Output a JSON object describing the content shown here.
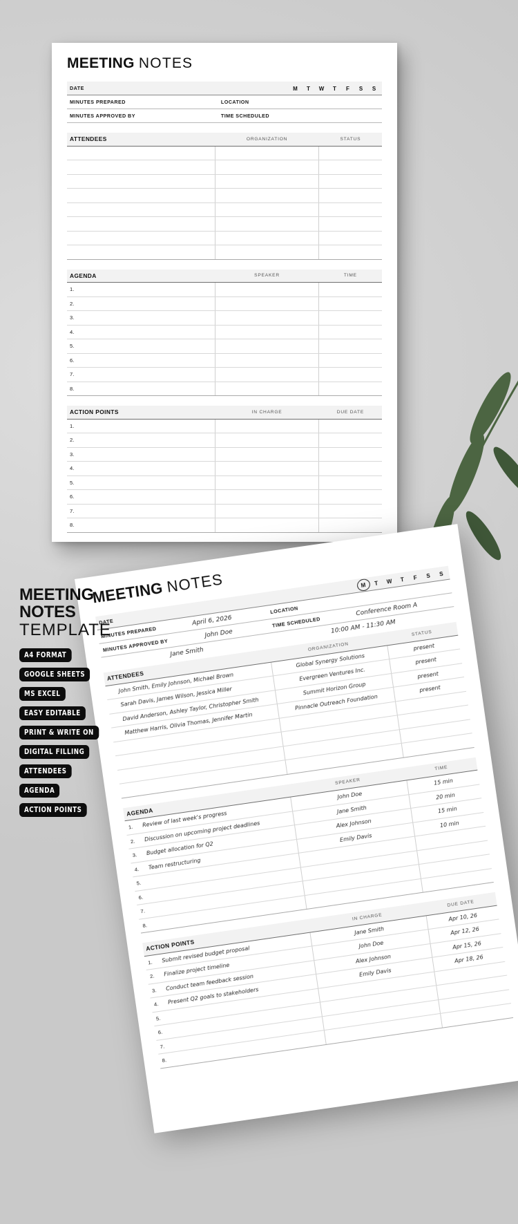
{
  "document": {
    "title_bold": "MEETING",
    "title_light": "NOTES",
    "meta": {
      "date_label": "DATE",
      "minutes_prepared_label": "MINUTES PREPARED",
      "minutes_approved_label": "MINUTES APPROVED BY",
      "location_label": "LOCATION",
      "time_scheduled_label": "TIME SCHEDULED",
      "days": [
        "M",
        "T",
        "W",
        "T",
        "F",
        "S",
        "S"
      ]
    },
    "attendees": {
      "header": "ATTENDEES",
      "col_organization": "ORGANIZATION",
      "col_status": "STATUS",
      "rows": 8
    },
    "agenda": {
      "header": "AGENDA",
      "col_speaker": "SPEAKER",
      "col_time": "TIME",
      "rows": 8
    },
    "action_points": {
      "header": "ACTION POINTS",
      "col_in_charge": "IN CHARGE",
      "col_due_date": "DUE DATE",
      "rows": 8
    }
  },
  "filled": {
    "date": "April 6, 2026",
    "minutes_prepared": "John Doe",
    "minutes_approved_by": "Jane Smith",
    "location": "Conference Room A",
    "time_scheduled": "10:00 AM - 11:30 AM",
    "day_selected": "M",
    "attendees": [
      {
        "names": "John Smith, Emily Johnson, Michael Brown",
        "organization": "Global Synergy Solutions",
        "status": "present"
      },
      {
        "names": "Sarah Davis, James Wilson, Jessica Miller",
        "organization": "Evergreen Ventures Inc.",
        "status": "present"
      },
      {
        "names": "David Anderson, Ashley Taylor, Christopher Smith",
        "organization": "Summit Horizon Group",
        "status": "present"
      },
      {
        "names": "Matthew Harris, Olivia Thomas, Jennifer Martin",
        "organization": "Pinnacle Outreach Foundation",
        "status": "present"
      }
    ],
    "agenda": [
      {
        "item": "Review of last week's progress",
        "speaker": "John Doe",
        "time": "15 min"
      },
      {
        "item": "Discussion on upcoming project deadlines",
        "speaker": "Jane Smith",
        "time": "20 min"
      },
      {
        "item": "Budget allocation for Q2",
        "speaker": "Alex Johnson",
        "time": "15 min"
      },
      {
        "item": "Team restructuring",
        "speaker": "Emily Davis",
        "time": "10 min"
      }
    ],
    "action_points": [
      {
        "item": "Submit revised budget proposal",
        "in_charge": "Jane Smith",
        "due_date": "Apr 10, 26"
      },
      {
        "item": "Finalize project timeline",
        "in_charge": "John Doe",
        "due_date": "Apr 12, 26"
      },
      {
        "item": "Conduct team feedback session",
        "in_charge": "Alex Johnson",
        "due_date": "Apr 15, 26"
      },
      {
        "item": "Present Q2 goals to stakeholders",
        "in_charge": "Emily Davis",
        "due_date": "Apr 18, 26"
      }
    ]
  },
  "promo": {
    "line1": "MEETING",
    "line2": "NOTES",
    "line3": "TEMPLATE",
    "badges": [
      "A4 FORMAT",
      "GOOGLE SHEETS",
      "MS EXCEL",
      "EASY EDITABLE",
      "PRINT & WRITE ON",
      "DIGITAL FILLING",
      "ATTENDEES",
      "AGENDA",
      "ACTION POINTS"
    ]
  },
  "colors": {
    "background": "#d2d2d2",
    "paper": "#ffffff",
    "ink": "#111111",
    "band": "#f2f2f2",
    "leaf": "#4a6340"
  }
}
